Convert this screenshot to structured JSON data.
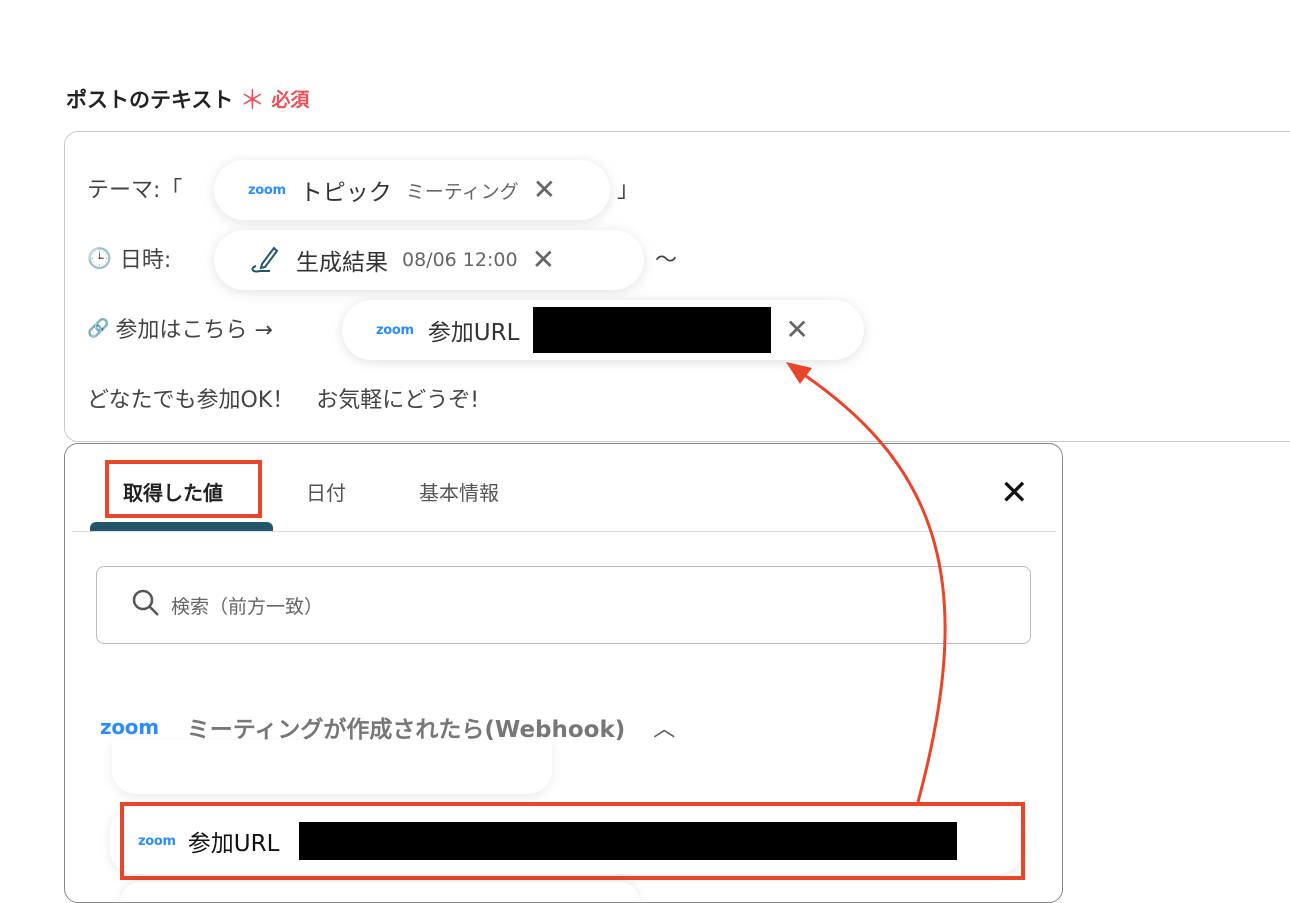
{
  "field": {
    "label": "ポストのテキスト",
    "required_mark": "＊",
    "required": "必須"
  },
  "editor": {
    "line1_prefix": "テーマ:「",
    "line1_suffix": "」",
    "pill1": {
      "icon": "zoom-logo",
      "logo": "zoom",
      "name": "トピック",
      "value": "ミーティング"
    },
    "line2_prefix": "日時:",
    "line2_icon": "clock-icon",
    "line2_suffix": "〜",
    "pill2": {
      "icon": "pencil-icon",
      "name": "生成結果",
      "value": "08/06 12:00"
    },
    "line3_prefix": "参加はこちら →",
    "line3_icon": "link-icon",
    "pill3": {
      "icon": "zoom-logo",
      "logo": "zoom",
      "name": "参加URL"
    },
    "line4": "どなたでも参加OK！　お気軽にどうぞ!"
  },
  "panel": {
    "tabs": [
      {
        "label": "取得した値",
        "active": true
      },
      {
        "label": "日付"
      },
      {
        "label": "基本情報"
      }
    ],
    "search_placeholder": "検索（前方一致）",
    "section": {
      "logo": "zoom",
      "title": "ミーティングが作成されたら(Webhook)"
    },
    "item": {
      "logo": "zoom",
      "name": "参加URL"
    }
  },
  "colors": {
    "accent": "#e8452b",
    "tab_indicator": "#24566b",
    "zoom": "#2d8cff",
    "required": "#e8505b"
  }
}
